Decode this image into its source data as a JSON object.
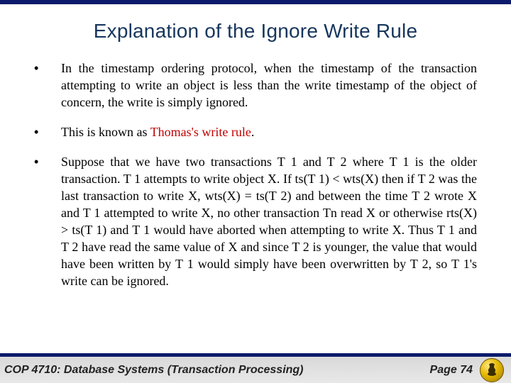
{
  "title": "Explanation of the Ignore Write Rule",
  "bullets": [
    {
      "segments": [
        {
          "text": "In the timestamp ordering protocol, when the timestamp of the transaction attempting to write an object is less than the write timestamp of the object of concern, the write is simply ignored."
        }
      ]
    },
    {
      "segments": [
        {
          "text": "This is known as "
        },
        {
          "text": "Thomas's write rule",
          "red": true
        },
        {
          "text": "."
        }
      ]
    },
    {
      "segments": [
        {
          "text": "Suppose that we have two transactions T 1 and T 2 where T 1 is the older transaction.  T 1 attempts to write object X.  If ts(T 1) < wts(X) then if T 2 was the last transaction to write X, wts(X) = ts(T 2) and between the time T 2 wrote X and T 1 attempted to write X, no other transaction Tn read X or otherwise rts(X) > ts(T 1) and T 1 would have aborted when attempting to write X.  Thus T 1 and T 2 have read the same value of X and since T 2 is younger, the value that would have been written by T 1 would simply have been overwritten by T 2, so T 1's write can be ignored."
        }
      ]
    }
  ],
  "footer": {
    "course": "COP 4710: Database Systems  (Transaction Processing)",
    "page": "Page 74"
  }
}
